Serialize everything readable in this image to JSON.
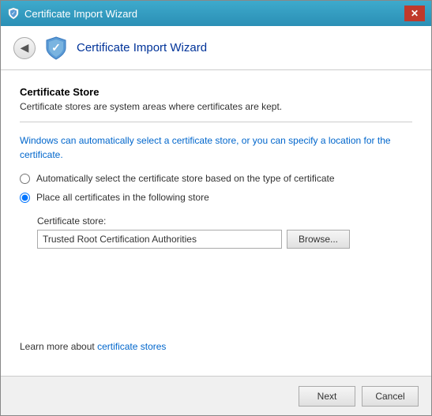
{
  "window": {
    "title": "Certificate Import Wizard",
    "close_label": "✕"
  },
  "header": {
    "back_icon": "◀",
    "title": "Certificate Import Wizard"
  },
  "content": {
    "section_title": "Certificate Store",
    "section_desc": "Certificate stores are system areas where certificates are kept.",
    "info_text": "Windows can automatically select a certificate store, or you can specify a location for the certificate.",
    "radio_auto_label": "Automatically select the certificate store based on the type of certificate",
    "radio_manual_label": "Place all certificates in the following store",
    "cert_store_label": "Certificate store:",
    "cert_store_value": "Trusted Root Certification Authorities",
    "browse_label": "Browse...",
    "footer_link_text": "Learn more about ",
    "footer_link_anchor": "certificate stores"
  },
  "footer": {
    "next_label": "Next",
    "cancel_label": "Cancel"
  }
}
